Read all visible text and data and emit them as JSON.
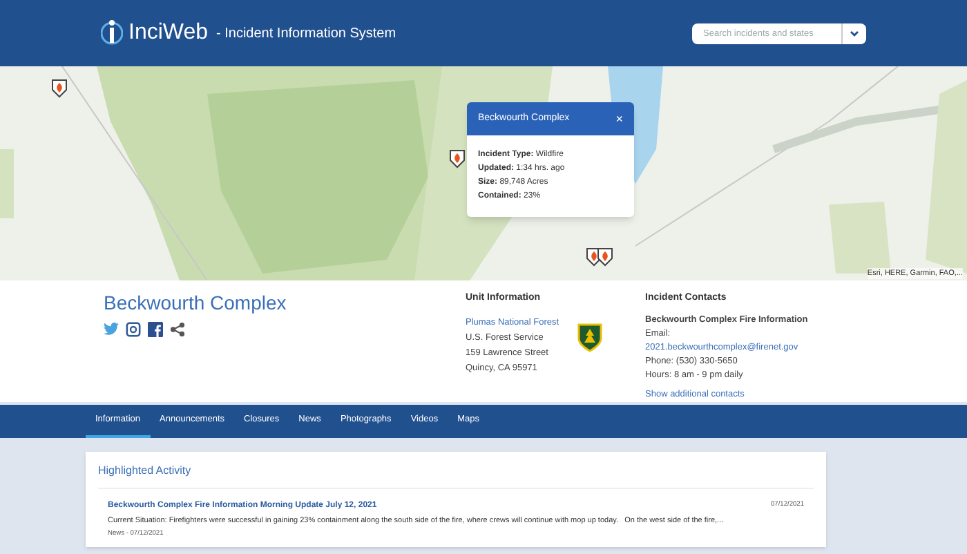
{
  "header": {
    "brand": "InciWeb",
    "subtitle": "- Incident Information System",
    "search": {
      "placeholder": "Search incidents and states"
    }
  },
  "map": {
    "attribution": "Esri, HERE, Garmin, FAO,...",
    "popup": {
      "title": "Beckwourth Complex",
      "close": "×",
      "fields": [
        {
          "label": "Incident Type:",
          "value": "Wildfire"
        },
        {
          "label": "Updated:",
          "value": "1:34 hrs. ago"
        },
        {
          "label": "Size:",
          "value": "89,748 Acres"
        },
        {
          "label": "Contained:",
          "value": "23%"
        }
      ]
    }
  },
  "incident": {
    "title": "Beckwourth Complex"
  },
  "unit_information": {
    "heading": "Unit Information",
    "link": "Plumas National Forest",
    "lines": [
      "U.S. Forest Service",
      "159 Lawrence Street",
      "Quincy, CA 95971"
    ]
  },
  "incident_contacts": {
    "heading": "Incident Contacts",
    "name": "Beckwourth Complex Fire Information",
    "email_label": "Email:",
    "email": "2021.beckwourthcomplex@firenet.gov",
    "phone": "Phone: (530) 330-5650",
    "hours": "Hours: 8 am - 9 pm daily",
    "more": "Show additional contacts"
  },
  "tabs": [
    {
      "label": "Information",
      "selected": true
    },
    {
      "label": "Announcements",
      "selected": false
    },
    {
      "label": "Closures",
      "selected": false
    },
    {
      "label": "News",
      "selected": false
    },
    {
      "label": "Photographs",
      "selected": false
    },
    {
      "label": "Videos",
      "selected": false
    },
    {
      "label": "Maps",
      "selected": false
    }
  ],
  "highlighted": {
    "heading": "Highlighted Activity",
    "items": [
      {
        "title": "Beckwourth Complex Fire Information Morning Update July 12, 2021",
        "date": "07/12/2021",
        "summary": "Current Situation: Firefighters were successful in gaining 23% containment along the south side of the fire, where crews will continue with mop up today.   On the west side of the fire,...",
        "meta": "News - 07/12/2021"
      }
    ]
  }
}
